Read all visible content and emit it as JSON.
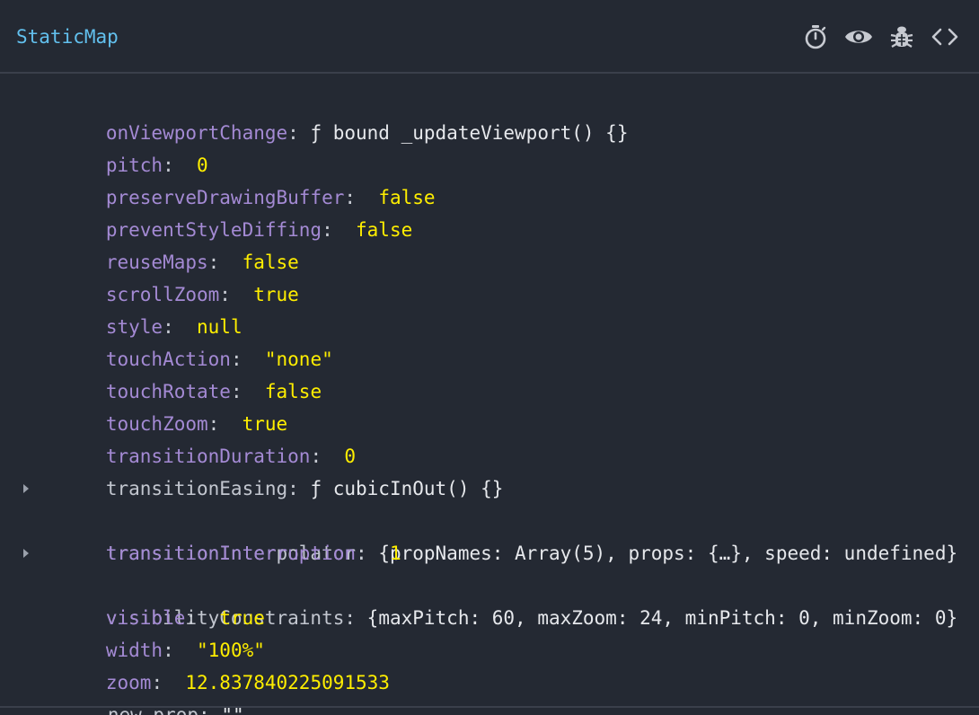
{
  "header": {
    "title": "StaticMap",
    "icons": [
      "stopwatch-icon",
      "eye-icon",
      "bug-icon",
      "code-icon"
    ]
  },
  "props": [
    {
      "key": "onViewportChange",
      "value": "ƒ bound _updateViewport() {}",
      "kind": "function",
      "expandable": false
    },
    {
      "key": "pitch",
      "value": "0",
      "kind": "literal",
      "expandable": false
    },
    {
      "key": "preserveDrawingBuffer",
      "value": "false",
      "kind": "literal",
      "expandable": false
    },
    {
      "key": "preventStyleDiffing",
      "value": "false",
      "kind": "literal",
      "expandable": false
    },
    {
      "key": "reuseMaps",
      "value": "false",
      "kind": "literal",
      "expandable": false
    },
    {
      "key": "scrollZoom",
      "value": "true",
      "kind": "literal",
      "expandable": false
    },
    {
      "key": "style",
      "value": "null",
      "kind": "literal",
      "expandable": false
    },
    {
      "key": "touchAction",
      "value": "\"none\"",
      "kind": "literal",
      "expandable": false
    },
    {
      "key": "touchRotate",
      "value": "false",
      "kind": "literal",
      "expandable": false
    },
    {
      "key": "touchZoom",
      "value": "true",
      "kind": "literal",
      "expandable": false
    },
    {
      "key": "transitionDuration",
      "value": "0",
      "kind": "literal",
      "expandable": false
    },
    {
      "key": "transitionEasing",
      "value": "ƒ cubicInOut() {}",
      "kind": "function",
      "expandable": false
    },
    {
      "key": "transitionInterpolator",
      "value": "{propNames: Array(5), props: {…}, speed: undefined}",
      "kind": "object",
      "expandable": true
    },
    {
      "key": "transitionInterruption",
      "value": "1",
      "kind": "literal",
      "expandable": false
    },
    {
      "key": "visibilityConstraints",
      "value": "{maxPitch: 60, maxZoom: 24, minPitch: 0, minZoom: 0}",
      "kind": "object",
      "expandable": true
    },
    {
      "key": "visible",
      "value": "true",
      "kind": "literal",
      "expandable": false
    },
    {
      "key": "width",
      "value": "\"100%\"",
      "kind": "literal",
      "expandable": false
    },
    {
      "key": "zoom",
      "value": "12.837840225091533",
      "kind": "literal",
      "expandable": false
    }
  ],
  "new_prop": {
    "key": "new prop",
    "value": "\"\""
  },
  "colors": {
    "background": "#242933",
    "title": "#62c0ee",
    "key": "#a48ad4",
    "literal": "#ffee00",
    "text": "#e6e8ec",
    "icon": "#c7cad1",
    "border": "#3a3f4b"
  }
}
